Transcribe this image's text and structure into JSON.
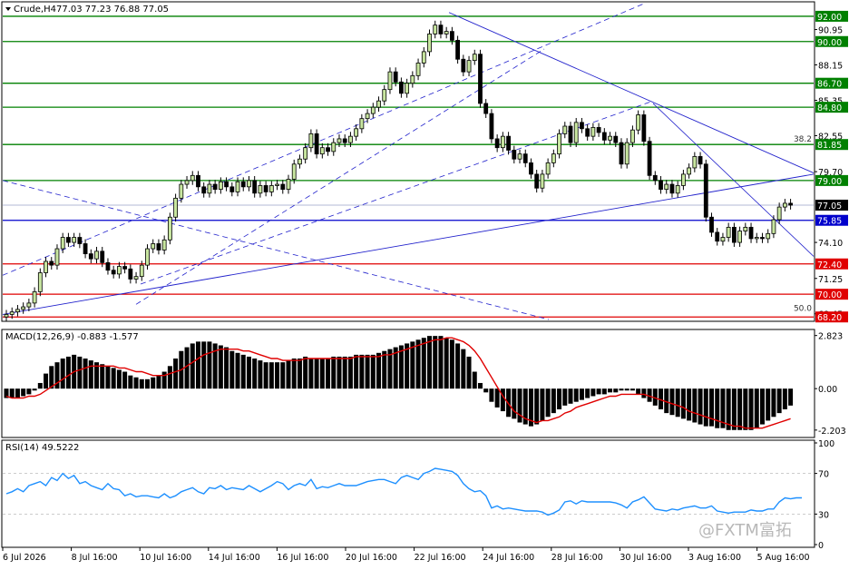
{
  "header": {
    "symbol_tf": "Crude,H4",
    "ohlc": "77.03 77.23 76.88 77.05"
  },
  "watermark": "@FXTM富拓",
  "colors": {
    "bull": "#c8e6a0",
    "bear": "#000000",
    "green_level": "#008000",
    "red_level": "#e00000",
    "blue_level": "#0000cc",
    "trend": "#2222cc",
    "macd_signal": "#e00000",
    "rsi": "#1e90ff",
    "price_tag_text": "#ffffff"
  },
  "chart_data": [
    {
      "type": "candlestick",
      "name": "price",
      "ylim": [
        68.0,
        93.0
      ],
      "y_ticks": [
        "92.00",
        "90.95",
        "90.00",
        "88.15",
        "86.70",
        "85.35",
        "84.80",
        "82.55",
        "81.85",
        "79.70",
        "79.00",
        "77.05",
        "75.85",
        "74.10",
        "72.40",
        "71.25",
        "70.00",
        "68.45",
        "68.20"
      ],
      "x_ticks": [
        "6 Jul 2026",
        "8 Jul 16:00",
        "10 Jul 16:00",
        "14 Jul 16:00",
        "16 Jul 16:00",
        "20 Jul 16:00",
        "22 Jul 16:00",
        "24 Jul 16:00",
        "28 Jul 16:00",
        "30 Jul 16:00",
        "3 Aug 16:00",
        "5 Aug 16:00"
      ],
      "levels": [
        {
          "value": 92.0,
          "label": "92.00",
          "color": "green"
        },
        {
          "value": 90.0,
          "label": "90.00",
          "color": "green"
        },
        {
          "value": 86.7,
          "label": "86.70",
          "color": "green"
        },
        {
          "value": 84.8,
          "label": "84.80",
          "color": "green"
        },
        {
          "value": 81.85,
          "label": "81.85",
          "color": "green"
        },
        {
          "value": 79.0,
          "label": "79.00",
          "color": "green"
        },
        {
          "value": 75.85,
          "label": "75.85",
          "color": "blue"
        },
        {
          "value": 72.4,
          "label": "72.40",
          "color": "red"
        },
        {
          "value": 70.0,
          "label": "70.00",
          "color": "red"
        },
        {
          "value": 68.2,
          "label": "68.20",
          "color": "red"
        }
      ],
      "fib_labels": [
        {
          "text": "38.2",
          "value": 81.85
        },
        {
          "text": "50.0",
          "value": 68.45
        }
      ],
      "current_price": {
        "value": 77.05,
        "label": "77.05"
      },
      "closes": [
        68.4,
        68.6,
        68.8,
        69.0,
        69.3,
        70.2,
        71.7,
        72.6,
        72.3,
        73.6,
        74.5,
        74.1,
        74.5,
        74.0,
        73.2,
        72.8,
        73.4,
        72.5,
        71.9,
        71.6,
        72.2,
        72.0,
        71.2,
        71.4,
        72.3,
        73.6,
        74.0,
        73.5,
        74.3,
        76.1,
        77.6,
        78.7,
        79.0,
        79.4,
        78.5,
        78.0,
        78.7,
        78.3,
        78.9,
        78.5,
        78.1,
        78.9,
        78.5,
        79.0,
        78.0,
        78.6,
        78.1,
        78.6,
        78.7,
        78.3,
        79.1,
        80.3,
        80.7,
        81.6,
        82.7,
        81.1,
        81.6,
        81.3,
        82.0,
        82.3,
        82.0,
        82.5,
        83.1,
        83.9,
        84.3,
        84.8,
        85.3,
        86.2,
        87.6,
        86.8,
        85.9,
        86.7,
        87.3,
        88.3,
        89.2,
        90.6,
        91.3,
        90.6,
        90.8,
        90.1,
        88.6,
        87.6,
        88.5,
        89.0,
        85.1,
        84.3,
        82.3,
        81.6,
        82.5,
        81.4,
        80.7,
        81.1,
        80.4,
        79.5,
        78.4,
        79.5,
        80.4,
        81.1,
        82.7,
        83.3,
        82.0,
        83.6,
        83.1,
        82.5,
        83.2,
        82.8,
        82.2,
        82.5,
        82.0,
        80.3,
        82.0,
        83.0,
        84.2,
        82.1,
        79.4,
        79.0,
        78.3,
        78.7,
        78.0,
        78.6,
        79.5,
        80.0,
        80.9,
        80.3,
        76.1,
        74.9,
        74.2,
        74.5,
        75.3,
        74.1,
        75.0,
        75.3,
        74.4,
        74.5,
        74.4,
        74.8,
        75.9,
        76.9,
        77.2,
        77.05
      ]
    },
    {
      "type": "histogram",
      "name": "MACD",
      "label": "MACD(12,26,9) -0.883 -1.577",
      "ylim": [
        -2.5,
        3.0
      ],
      "y_ticks": [
        "2.823",
        "0.00",
        "-2.203"
      ],
      "hist": [
        -0.5,
        -0.5,
        -0.5,
        -0.4,
        -0.3,
        -0.1,
        0.3,
        0.8,
        1.2,
        1.4,
        1.6,
        1.7,
        1.8,
        1.7,
        1.6,
        1.5,
        1.4,
        1.3,
        1.2,
        1.1,
        1.0,
        0.9,
        0.7,
        0.6,
        0.5,
        0.5,
        0.6,
        0.7,
        0.9,
        1.2,
        1.6,
        2.0,
        2.2,
        2.4,
        2.5,
        2.5,
        2.5,
        2.4,
        2.3,
        2.2,
        2.0,
        1.9,
        1.8,
        1.7,
        1.6,
        1.5,
        1.4,
        1.4,
        1.4,
        1.4,
        1.5,
        1.6,
        1.6,
        1.7,
        1.6,
        1.6,
        1.6,
        1.6,
        1.7,
        1.7,
        1.7,
        1.7,
        1.8,
        1.8,
        1.8,
        1.8,
        1.9,
        2.0,
        2.1,
        2.2,
        2.3,
        2.4,
        2.5,
        2.6,
        2.7,
        2.8,
        2.8,
        2.8,
        2.7,
        2.6,
        2.4,
        2.1,
        1.7,
        0.9,
        0.3,
        -0.2,
        -0.7,
        -1.0,
        -1.2,
        -1.5,
        -1.6,
        -1.8,
        -1.9,
        -2.0,
        -1.9,
        -1.7,
        -1.5,
        -1.3,
        -1.1,
        -0.9,
        -0.8,
        -0.7,
        -0.6,
        -0.5,
        -0.4,
        -0.3,
        -0.3,
        -0.2,
        -0.2,
        -0.1,
        -0.1,
        -0.1,
        -0.3,
        -0.5,
        -0.7,
        -0.9,
        -1.1,
        -1.3,
        -1.4,
        -1.5,
        -1.6,
        -1.7,
        -1.8,
        -1.9,
        -2.0,
        -2.0,
        -2.1,
        -2.1,
        -2.2,
        -2.2,
        -2.2,
        -2.2,
        -2.2,
        -2.1,
        -1.9,
        -1.7,
        -1.5,
        -1.3,
        -1.1,
        -0.9
      ],
      "signal": [
        -0.4,
        -0.5,
        -0.5,
        -0.5,
        -0.4,
        -0.4,
        -0.3,
        -0.1,
        0.1,
        0.3,
        0.5,
        0.7,
        0.9,
        1.0,
        1.1,
        1.2,
        1.2,
        1.2,
        1.2,
        1.2,
        1.1,
        1.1,
        1.0,
        0.9,
        0.9,
        0.8,
        0.7,
        0.7,
        0.7,
        0.8,
        0.9,
        1.0,
        1.2,
        1.4,
        1.6,
        1.8,
        1.9,
        2.0,
        2.1,
        2.1,
        2.1,
        2.1,
        2.0,
        2.0,
        1.9,
        1.8,
        1.7,
        1.6,
        1.6,
        1.5,
        1.5,
        1.5,
        1.5,
        1.6,
        1.6,
        1.6,
        1.6,
        1.6,
        1.6,
        1.6,
        1.6,
        1.6,
        1.7,
        1.7,
        1.7,
        1.7,
        1.7,
        1.8,
        1.8,
        1.9,
        2.0,
        2.1,
        2.2,
        2.3,
        2.4,
        2.5,
        2.6,
        2.6,
        2.7,
        2.7,
        2.6,
        2.5,
        2.3,
        2.0,
        1.6,
        1.1,
        0.6,
        0.1,
        -0.4,
        -0.8,
        -1.2,
        -1.4,
        -1.6,
        -1.7,
        -1.8,
        -1.7,
        -1.7,
        -1.6,
        -1.5,
        -1.3,
        -1.2,
        -1.0,
        -0.9,
        -0.8,
        -0.7,
        -0.6,
        -0.5,
        -0.4,
        -0.4,
        -0.3,
        -0.3,
        -0.3,
        -0.3,
        -0.3,
        -0.4,
        -0.5,
        -0.6,
        -0.7,
        -0.8,
        -0.9,
        -1.0,
        -1.2,
        -1.3,
        -1.4,
        -1.5,
        -1.6,
        -1.7,
        -1.8,
        -1.9,
        -2.0,
        -2.0,
        -2.1,
        -2.1,
        -2.1,
        -2.1,
        -2.0,
        -1.9,
        -1.8,
        -1.7,
        -1.6
      ]
    },
    {
      "type": "line",
      "name": "RSI",
      "label": "RSI(14) 49.5222",
      "ylim": [
        0,
        100
      ],
      "y_ticks": [
        "100",
        "70",
        "30",
        "0"
      ],
      "levels": [
        70,
        30
      ],
      "values": [
        50,
        52,
        55,
        52,
        58,
        60,
        62,
        58,
        66,
        63,
        70,
        65,
        68,
        60,
        62,
        58,
        56,
        54,
        60,
        55,
        54,
        48,
        50,
        47,
        48,
        48,
        47,
        46,
        50,
        46,
        48,
        52,
        54,
        56,
        52,
        50,
        56,
        55,
        58,
        54,
        56,
        55,
        54,
        58,
        55,
        52,
        55,
        58,
        62,
        60,
        54,
        58,
        60,
        58,
        64,
        55,
        57,
        56,
        58,
        60,
        58,
        58,
        58,
        60,
        62,
        63,
        64,
        64,
        62,
        60,
        66,
        68,
        66,
        64,
        70,
        72,
        75,
        74,
        73,
        72,
        68,
        60,
        55,
        52,
        53,
        48,
        36,
        38,
        35,
        36,
        35,
        34,
        33,
        33,
        33,
        32,
        29,
        31,
        34,
        42,
        43,
        40,
        43,
        42,
        42,
        42,
        42,
        42,
        41,
        39,
        36,
        42,
        44,
        47,
        41,
        35,
        34,
        33,
        35,
        34,
        36,
        37,
        38,
        36,
        36,
        38,
        33,
        32,
        31,
        32,
        32,
        32,
        34,
        33,
        33,
        35,
        35,
        42,
        46,
        45,
        46,
        46
      ]
    }
  ]
}
